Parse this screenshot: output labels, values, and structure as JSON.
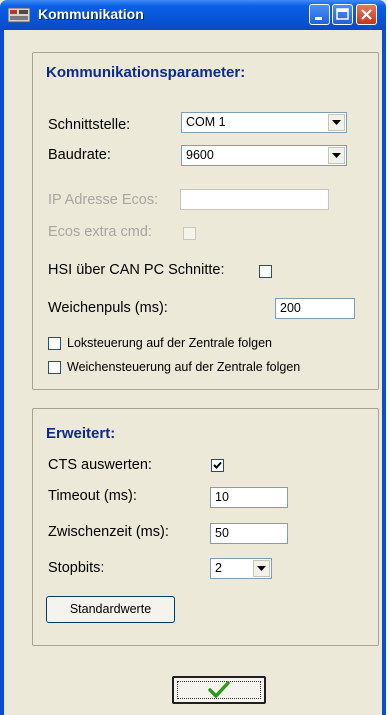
{
  "window": {
    "title": "Kommunikation"
  },
  "group_communication": {
    "title": "Kommunikationsparameter:",
    "interface_label": "Schnittstelle:",
    "interface_value": "COM 1",
    "baud_label": "Baudrate:",
    "baud_value": "9600",
    "ip_label": "IP Adresse Ecos:",
    "ip_value": "",
    "ecos_cmd_label": "Ecos extra cmd:",
    "ecos_cmd_checked": false,
    "hsi_label": "HSI über CAN PC Schnitte:",
    "hsi_checked": false,
    "switch_pulse_label": "Weichenpuls (ms):",
    "switch_pulse_value": "200",
    "loco_follow_label": "Loksteuerung auf der Zentrale folgen",
    "loco_follow_checked": false,
    "switch_follow_label": "Weichensteuerung auf der Zentrale folgen",
    "switch_follow_checked": false
  },
  "group_extended": {
    "title": "Erweitert:",
    "cts_label": "CTS auswerten:",
    "cts_checked": true,
    "timeout_label": "Timeout (ms):",
    "timeout_value": "10",
    "interval_label": "Zwischenzeit (ms):",
    "interval_value": "50",
    "stopbits_label": "Stopbits:",
    "stopbits_value": "2",
    "defaults_button": "Standardwerte"
  },
  "ok_button": {
    "icon": "checkmark-icon"
  },
  "colors": {
    "title_bar": "#0756D8",
    "group_title": "#0B2A8C",
    "ok_check": "#2E9A1B"
  }
}
